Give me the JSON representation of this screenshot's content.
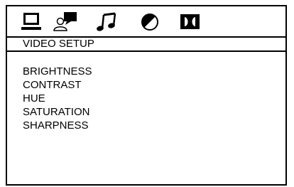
{
  "menu_title": "VIDEO SETUP",
  "tabs": [
    {
      "icon": "monitor-icon"
    },
    {
      "icon": "speech-bubble-person-icon"
    },
    {
      "icon": "music-note-icon"
    },
    {
      "icon": "circle-half-icon"
    },
    {
      "icon": "dolby-icon"
    }
  ],
  "items": [
    {
      "label": "BRIGHTNESS"
    },
    {
      "label": "CONTRAST"
    },
    {
      "label": "HUE"
    },
    {
      "label": "SATURATION"
    },
    {
      "label": "SHARPNESS"
    }
  ],
  "colors": {
    "foreground": "#000000",
    "background": "#ffffff"
  }
}
